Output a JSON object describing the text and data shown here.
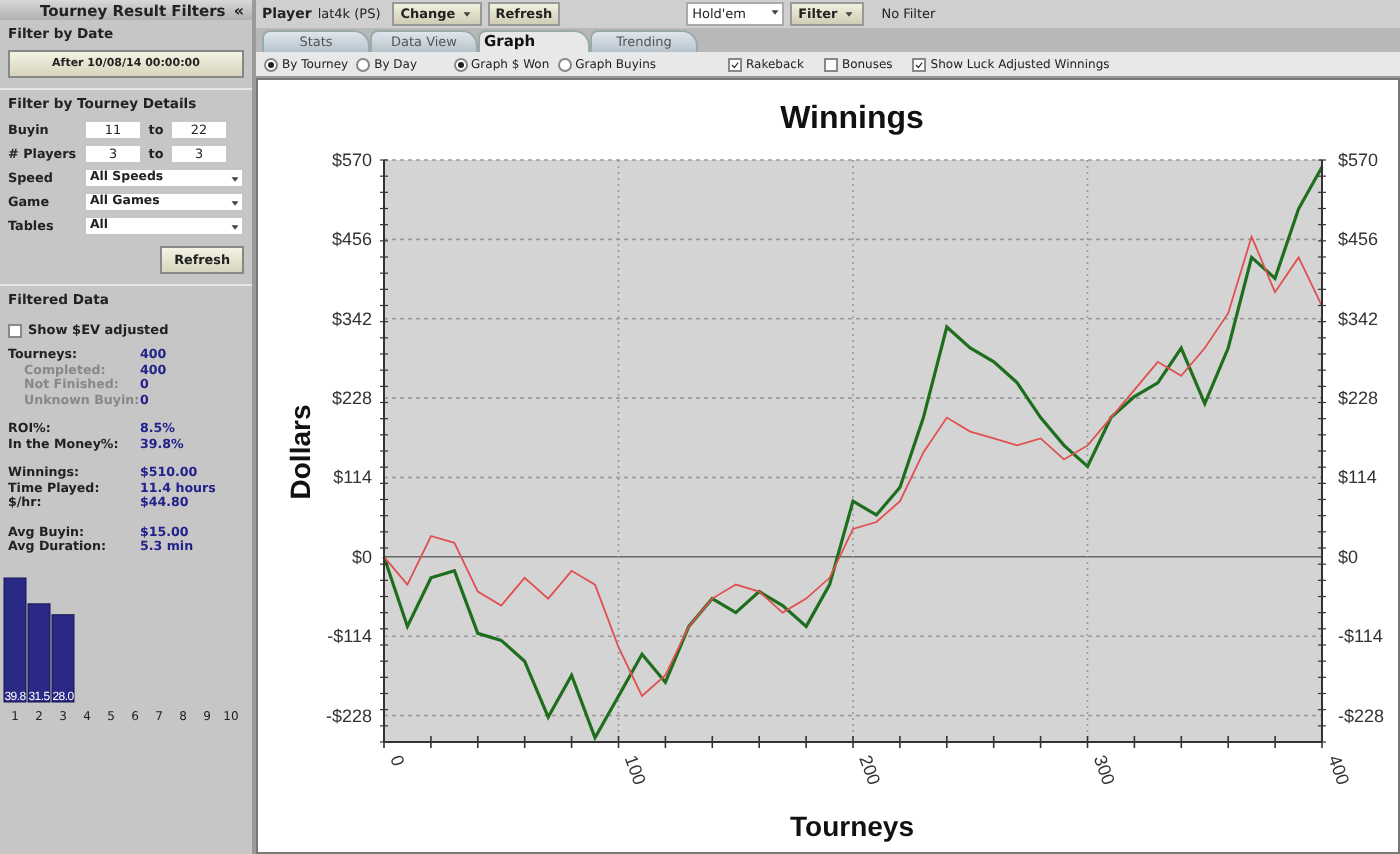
{
  "sidebar": {
    "title": "Tourney Result Filters",
    "collapse": "«",
    "date_section": {
      "heading": "Filter by Date",
      "button": "After 10/08/14 00:00:00"
    },
    "details_section": {
      "heading": "Filter by Tourney Details",
      "ranges": [
        {
          "label": "Buyin",
          "from": "11",
          "to_label": "to",
          "to": "22"
        },
        {
          "label": "# Players",
          "from": "3",
          "to_label": "to",
          "to": "3"
        }
      ],
      "selects": [
        {
          "label": "Speed",
          "value": "All Speeds"
        },
        {
          "label": "Game",
          "value": "All Games"
        },
        {
          "label": "Tables",
          "value": "All"
        }
      ],
      "button": "Refresh"
    },
    "filtered": {
      "heading": "Filtered Data",
      "checkbox": {
        "label": "Show $EV adjusted",
        "checked": false
      },
      "groups": [
        [
          {
            "label": "Tourneys:",
            "value": "400",
            "sub": false
          },
          {
            "label": "Completed:",
            "value": "400",
            "sub": true
          },
          {
            "label": "Not Finished:",
            "value": "0",
            "sub": true
          },
          {
            "label": "Unknown Buyin:",
            "value": "0",
            "sub": true
          }
        ],
        [
          {
            "label": "ROI%:",
            "value": "8.5%",
            "sub": false
          },
          {
            "label": "In the Money%:",
            "value": "39.8%",
            "sub": false
          }
        ],
        [
          {
            "label": "Winnings:",
            "value": "$510.00",
            "sub": false
          },
          {
            "label": "Time Played:",
            "value": "11.4 hours",
            "sub": false
          },
          {
            "label": "$/hr:",
            "value": "$44.80",
            "sub": false
          }
        ],
        [
          {
            "label": "Avg Buyin:",
            "value": "$15.00",
            "sub": false
          },
          {
            "label": "Avg Duration:",
            "value": "5.3 min",
            "sub": false
          }
        ]
      ],
      "chart_data": {
        "type": "bar",
        "categories": [
          "1",
          "2",
          "3",
          "4",
          "5",
          "6",
          "7",
          "8",
          "9",
          "10"
        ],
        "values": [
          39.8,
          31.5,
          28.0,
          null,
          null,
          null,
          null,
          null,
          null,
          null
        ],
        "value_labels": [
          "39.8",
          "31.5",
          "28.0",
          null,
          null,
          null,
          null,
          null,
          null,
          null
        ]
      }
    }
  },
  "toolbar": {
    "label": "Player",
    "player": "lat4k (PS)",
    "buttons": [
      {
        "label": "Change",
        "dropdown": true
      },
      {
        "label": "Refresh",
        "dropdown": false
      }
    ],
    "game": "Hold'em",
    "filter_button": "Filter",
    "filter_status": "No Filter"
  },
  "tabs": [
    {
      "label": "Stats",
      "selected": false
    },
    {
      "label": "Data View",
      "selected": false
    },
    {
      "label": "Graph",
      "selected": true
    },
    {
      "label": "Trending",
      "selected": false
    }
  ],
  "options": [
    {
      "kind": "radio",
      "label": "By Tourney",
      "selected": true
    },
    {
      "kind": "radio",
      "label": "By Day",
      "selected": false
    },
    {
      "kind": "radio",
      "label": "Graph $ Won",
      "selected": true
    },
    {
      "kind": "radio",
      "label": "Graph Buyins",
      "selected": false
    },
    {
      "kind": "checkbox",
      "label": "Rakeback",
      "checked": true
    },
    {
      "kind": "checkbox",
      "label": "Bonuses",
      "checked": false
    },
    {
      "kind": "checkbox",
      "label": "Show Luck Adjusted Winnings",
      "checked": true
    }
  ],
  "chart_data": {
    "type": "line",
    "title": "Winnings",
    "xlabel": "Tourneys",
    "ylabel": "Dollars",
    "x": [
      0,
      10,
      20,
      30,
      40,
      50,
      60,
      70,
      80,
      90,
      100,
      110,
      120,
      130,
      140,
      150,
      160,
      170,
      180,
      190,
      200,
      210,
      220,
      230,
      240,
      250,
      260,
      270,
      280,
      290,
      300,
      310,
      320,
      330,
      340,
      350,
      360,
      370,
      380,
      390,
      400
    ],
    "series": [
      {
        "color": "#1e6e1e",
        "values": [
          0,
          -100,
          -30,
          -20,
          -110,
          -120,
          -150,
          -230,
          -170,
          -260,
          -200,
          -140,
          -180,
          -100,
          -60,
          -80,
          -50,
          -70,
          -100,
          -40,
          80,
          60,
          100,
          200,
          330,
          300,
          280,
          250,
          200,
          160,
          130,
          200,
          230,
          250,
          300,
          220,
          300,
          430,
          400,
          500,
          560
        ]
      },
      {
        "color": "#e05050",
        "values": [
          0,
          -40,
          30,
          20,
          -50,
          -70,
          -30,
          -60,
          -20,
          -40,
          -130,
          -200,
          -170,
          -100,
          -60,
          -40,
          -50,
          -80,
          -60,
          -30,
          40,
          50,
          80,
          150,
          200,
          180,
          170,
          160,
          170,
          140,
          160,
          200,
          240,
          280,
          260,
          300,
          350,
          460,
          380,
          430,
          360
        ]
      }
    ],
    "grid": true,
    "xlim": [
      0,
      400
    ],
    "ylim": [
      -266,
      570
    ],
    "xticks": [
      {
        "value": 0,
        "label": "0"
      },
      {
        "value": 100,
        "label": "100"
      },
      {
        "value": 200,
        "label": "200"
      },
      {
        "value": 300,
        "label": "300"
      },
      {
        "value": 400,
        "label": "400"
      }
    ],
    "yticks": [
      {
        "value": 570,
        "label": "$570"
      },
      {
        "value": 456,
        "label": "$456"
      },
      {
        "value": 342,
        "label": "$342"
      },
      {
        "value": 228,
        "label": "$228"
      },
      {
        "value": 114,
        "label": "$114"
      },
      {
        "value": 0,
        "label": "$0"
      },
      {
        "value": -114,
        "label": "-$114"
      },
      {
        "value": -228,
        "label": "-$228"
      }
    ]
  }
}
